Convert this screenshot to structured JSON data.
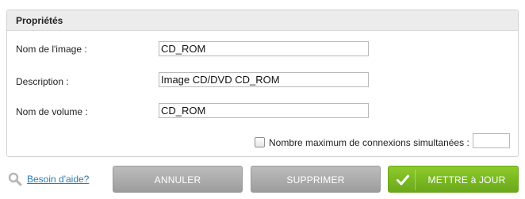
{
  "panel": {
    "title": "Propriétés",
    "fields": {
      "image_name": {
        "label": "Nom de l'image :",
        "value": "CD_ROM"
      },
      "description": {
        "label": "Description :",
        "value": "Image CD/DVD CD_ROM"
      },
      "volume_name": {
        "label": "Nom de volume :",
        "value": "CD_ROM"
      }
    },
    "max_connections": {
      "label": "Nombre maximum de connexions simultanées :",
      "checked": false,
      "value": ""
    }
  },
  "footer": {
    "help_label": "Besoin d'aide?",
    "cancel_label": "ANNULER",
    "delete_label": "SUPPRIMER",
    "save_label": "METTRE à JOUR"
  },
  "icons": {
    "help": "magnifier-icon",
    "save": "checkmark-icon"
  },
  "colors": {
    "save_button": "#7bb823",
    "gray_button": "#a9a9a9",
    "link": "#2a7ab6"
  }
}
